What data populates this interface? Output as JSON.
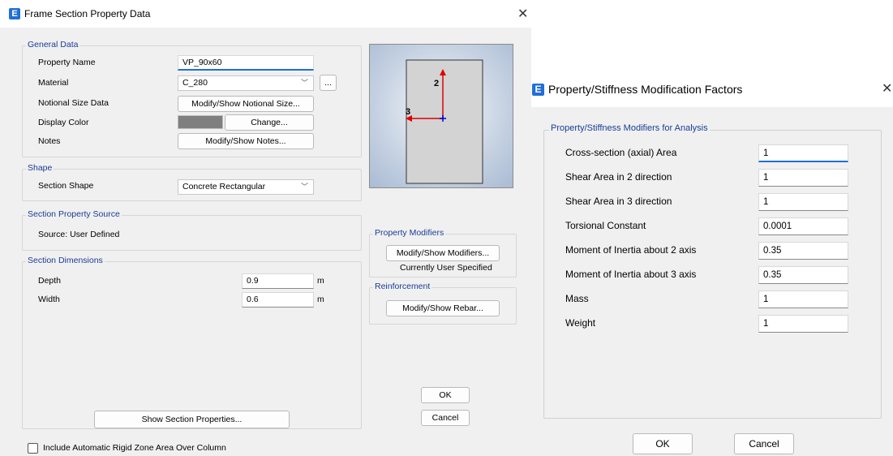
{
  "window1": {
    "title": "Frame Section Property Data",
    "app_icon": "E",
    "general_data": {
      "title": "General Data",
      "property_name_label": "Property Name",
      "property_name_value": "VP_90x60",
      "material_label": "Material",
      "material_value": "C_280",
      "ellipsis_label": "...",
      "notional_label": "Notional Size Data",
      "notional_button": "Modify/Show Notional Size...",
      "display_color_label": "Display Color",
      "display_color": "#7f7f7f",
      "change_button": "Change...",
      "notes_label": "Notes",
      "notes_button": "Modify/Show Notes..."
    },
    "shape": {
      "title": "Shape",
      "section_shape_label": "Section Shape",
      "section_shape_value": "Concrete Rectangular"
    },
    "source": {
      "title": "Section Property Source",
      "text": "Source:  User Defined"
    },
    "dimensions": {
      "title": "Section Dimensions",
      "depth_label": "Depth",
      "depth_value": "0.9",
      "depth_unit": "m",
      "width_label": "Width",
      "width_value": "0.6",
      "width_unit": "m"
    },
    "preview": {
      "axis2_label": "2",
      "axis3_label": "3"
    },
    "property_modifiers": {
      "title": "Property Modifiers",
      "button": "Modify/Show Modifiers...",
      "status": "Currently User Specified"
    },
    "reinforcement": {
      "title": "Reinforcement",
      "button": "Modify/Show Rebar..."
    },
    "show_section_button": "Show Section Properties...",
    "ok_button": "OK",
    "cancel_button": "Cancel",
    "rigid_zone_checkbox_label": "Include Automatic Rigid Zone Area Over Column"
  },
  "window2": {
    "title": "Property/Stiffness Modification Factors",
    "app_icon": "E",
    "group_title": "Property/Stiffness Modifiers for Analysis",
    "rows": [
      {
        "label": "Cross-section (axial) Area",
        "value": "1"
      },
      {
        "label": "Shear Area in 2 direction",
        "value": "1"
      },
      {
        "label": "Shear Area in 3 direction",
        "value": "1"
      },
      {
        "label": "Torsional Constant",
        "value": "0.0001"
      },
      {
        "label": "Moment of Inertia about 2 axis",
        "value": "0.35"
      },
      {
        "label": "Moment of Inertia about 3 axis",
        "value": "0.35"
      },
      {
        "label": "Mass",
        "value": "1"
      },
      {
        "label": "Weight",
        "value": "1"
      }
    ],
    "ok_button": "OK",
    "cancel_button": "Cancel"
  },
  "colors": {
    "accent": "#1f6fd6",
    "group_title": "#1a3c96",
    "axis": "#e00000"
  }
}
